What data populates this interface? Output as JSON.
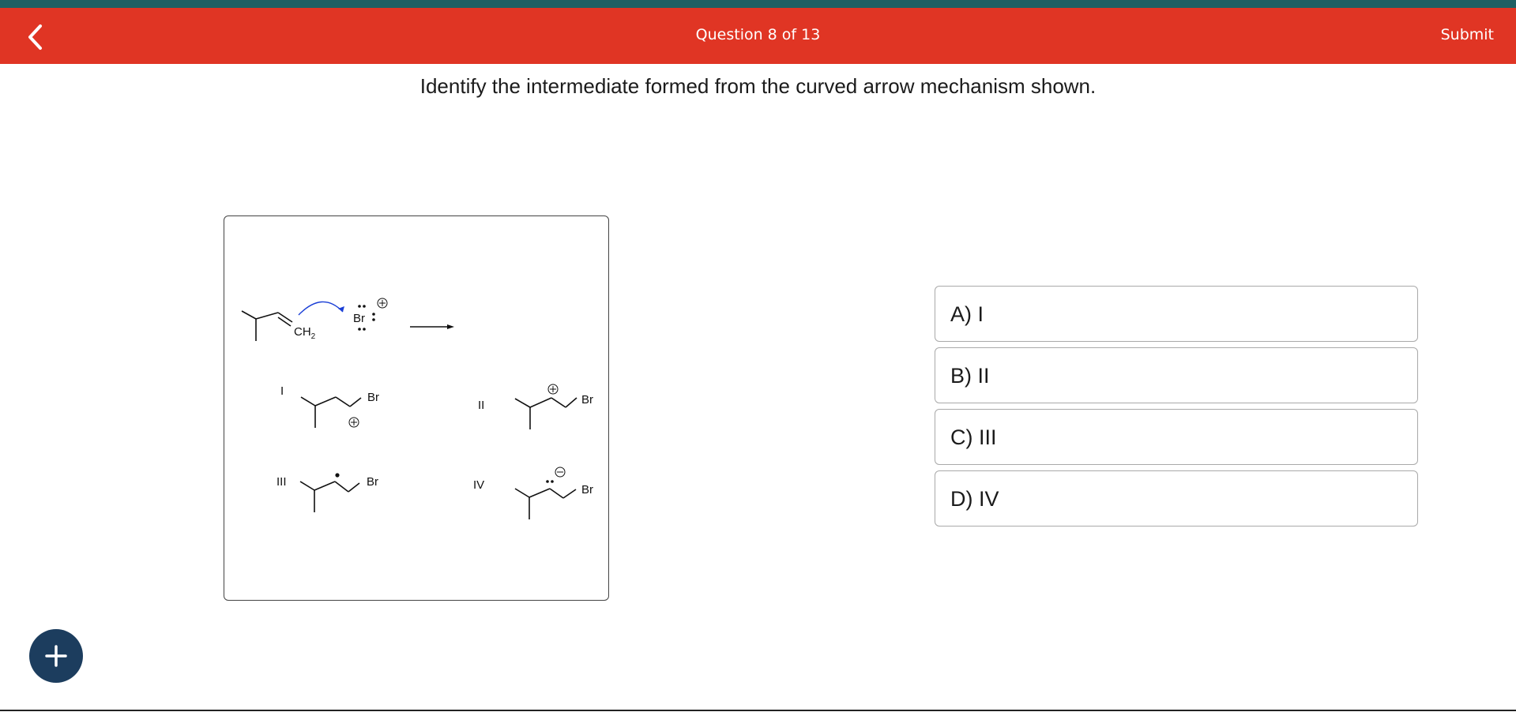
{
  "header": {
    "title": "Question 8 of 13",
    "submit_label": "Submit",
    "back_icon": "chevron-left-icon"
  },
  "question": {
    "prompt": "Identify the intermediate formed from the curved arrow mechanism shown."
  },
  "figure": {
    "reactant_label": "CH",
    "reactant_subscript": "2",
    "reagent_label": "Br",
    "choices": [
      {
        "numeral": "I",
        "atom": "Br"
      },
      {
        "numeral": "II",
        "atom": "Br"
      },
      {
        "numeral": "III",
        "atom": "Br"
      },
      {
        "numeral": "IV",
        "atom": "Br"
      }
    ]
  },
  "options": [
    {
      "label": "A) I"
    },
    {
      "label": "B) II"
    },
    {
      "label": "C) III"
    },
    {
      "label": "D) IV"
    }
  ],
  "fab": {
    "icon": "plus-icon"
  },
  "colors": {
    "header_bg": "#e03524",
    "top_stripe": "#1f5f63",
    "fab_bg": "#1c3d5e",
    "curved_arrow": "#1a3fd6"
  }
}
